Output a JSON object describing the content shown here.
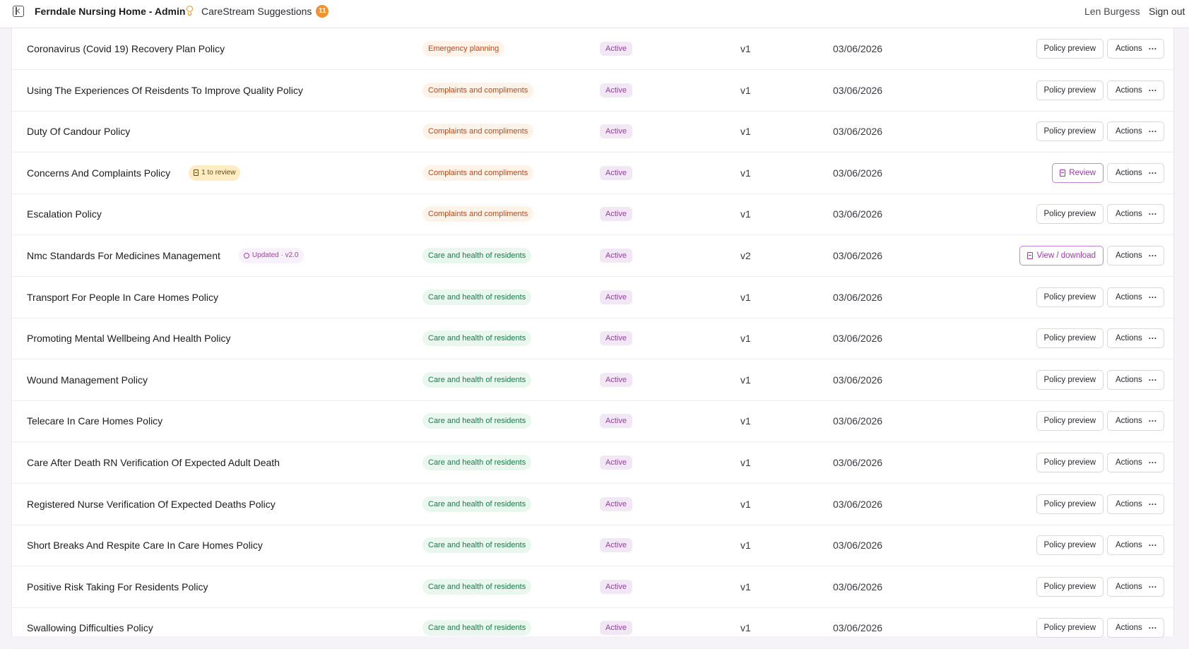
{
  "header": {
    "app_title": "Ferndale Nursing Home - Admin",
    "suggestions_label": "CareStream Suggestions",
    "suggestions_count": "11",
    "user_name": "Len Burgess",
    "sign_out_label": "Sign out",
    "accent_color": "#f0922d"
  },
  "colors": {
    "status_active": "#9b3aa6",
    "category_orange": "#c0461a",
    "category_green": "#1c7a47",
    "purple_action": "#a036b0"
  },
  "policies": [
    {
      "name": "Coronavirus (Covid 19) Recovery Plan Policy",
      "category": "Emergency planning",
      "status": "Active",
      "version": "v1",
      "date": "03/06/2026",
      "primary_action": "Policy preview",
      "actions_label": "Actions"
    },
    {
      "name": "Using The Experiences Of Reisdents To Improve Quality Policy",
      "category": "Complaints and compliments",
      "status": "Active",
      "version": "v1",
      "date": "03/06/2026",
      "primary_action": "Policy preview",
      "actions_label": "Actions"
    },
    {
      "name": "Duty Of Candour Policy",
      "category": "Complaints and compliments",
      "status": "Active",
      "version": "v1",
      "date": "03/06/2026",
      "primary_action": "Policy preview",
      "actions_label": "Actions"
    },
    {
      "name": "Concerns And Complaints Policy",
      "tag": "1 to review",
      "category": "Complaints and compliments",
      "status": "Active",
      "version": "v1",
      "date": "03/06/2026",
      "primary_action": "Review",
      "actions_label": "Actions"
    },
    {
      "name": "Escalation Policy",
      "category": "Complaints and compliments",
      "status": "Active",
      "version": "v1",
      "date": "03/06/2026",
      "primary_action": "Policy preview",
      "actions_label": "Actions"
    },
    {
      "name": "Nmc Standards For Medicines Management",
      "tag": "Updated · v2.0",
      "category": "Care and health of residents",
      "status": "Active",
      "version": "v2",
      "date": "03/06/2026",
      "primary_action": "View / download",
      "actions_label": "Actions"
    },
    {
      "name": "Transport For People In Care Homes Policy",
      "category": "Care and health of residents",
      "status": "Active",
      "version": "v1",
      "date": "03/06/2026",
      "primary_action": "Policy preview",
      "actions_label": "Actions"
    },
    {
      "name": "Promoting Mental Wellbeing And Health Policy",
      "category": "Care and health of residents",
      "status": "Active",
      "version": "v1",
      "date": "03/06/2026",
      "primary_action": "Policy preview",
      "actions_label": "Actions"
    },
    {
      "name": "Wound Management Policy",
      "category": "Care and health of residents",
      "status": "Active",
      "version": "v1",
      "date": "03/06/2026",
      "primary_action": "Policy preview",
      "actions_label": "Actions"
    },
    {
      "name": "Telecare In Care Homes Policy",
      "category": "Care and health of residents",
      "status": "Active",
      "version": "v1",
      "date": "03/06/2026",
      "primary_action": "Policy preview",
      "actions_label": "Actions"
    },
    {
      "name": "Care After Death RN Verification Of Expected Adult Death",
      "category": "Care and health of residents",
      "status": "Active",
      "version": "v1",
      "date": "03/06/2026",
      "primary_action": "Policy preview",
      "actions_label": "Actions"
    },
    {
      "name": "Registered Nurse Verification Of Expected Deaths Policy",
      "category": "Care and health of residents",
      "status": "Active",
      "version": "v1",
      "date": "03/06/2026",
      "primary_action": "Policy preview",
      "actions_label": "Actions"
    },
    {
      "name": "Short Breaks And Respite Care In Care Homes Policy",
      "category": "Care and health of residents",
      "status": "Active",
      "version": "v1",
      "date": "03/06/2026",
      "primary_action": "Policy preview",
      "actions_label": "Actions"
    },
    {
      "name": "Positive Risk Taking For Residents Policy",
      "category": "Care and health of residents",
      "status": "Active",
      "version": "v1",
      "date": "03/06/2026",
      "primary_action": "Policy preview",
      "actions_label": "Actions"
    },
    {
      "name": "Swallowing Difficulties Policy",
      "category": "Care and health of residents",
      "status": "Active",
      "version": "v1",
      "date": "03/06/2026",
      "primary_action": "Policy preview",
      "actions_label": "Actions"
    }
  ]
}
